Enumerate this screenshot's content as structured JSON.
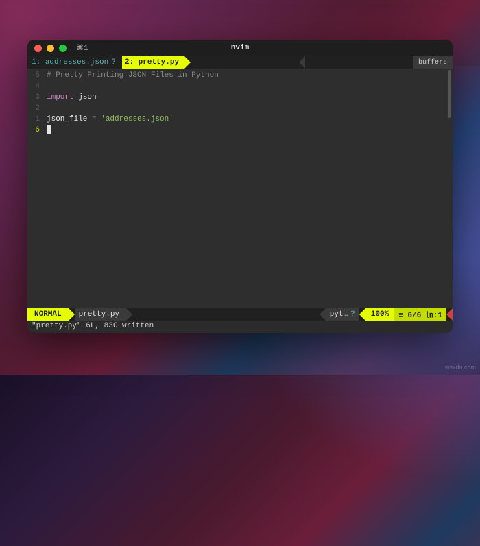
{
  "window": {
    "tab_label": "⌘1",
    "title": "nvim"
  },
  "buffers": {
    "label": "buffers",
    "items": [
      {
        "index": "1:",
        "name": "addresses.json",
        "flag": "?",
        "active": false
      },
      {
        "index": "2:",
        "name": "pretty.py",
        "flag": "",
        "active": true
      }
    ]
  },
  "gutter": [
    "5",
    "4",
    "3",
    "2",
    "1",
    "6"
  ],
  "code": {
    "l1_comment": "# Pretty Printing JSON Files in Python",
    "l2": "",
    "l3_kw": "import",
    "l3_mod": " json",
    "l4": "",
    "l5_var": "json_file",
    "l5_op": " = ",
    "l5_str": "'addresses.json'"
  },
  "status": {
    "mode": "NORMAL",
    "filename": "pretty.py",
    "filetype": "pyt…",
    "filetype_flag": "?",
    "percent": "100%",
    "position": "≡ 6/6 ㏑:1"
  },
  "cmdline": "\"pretty.py\" 6L, 83C written",
  "watermark": "wsxdn.com"
}
